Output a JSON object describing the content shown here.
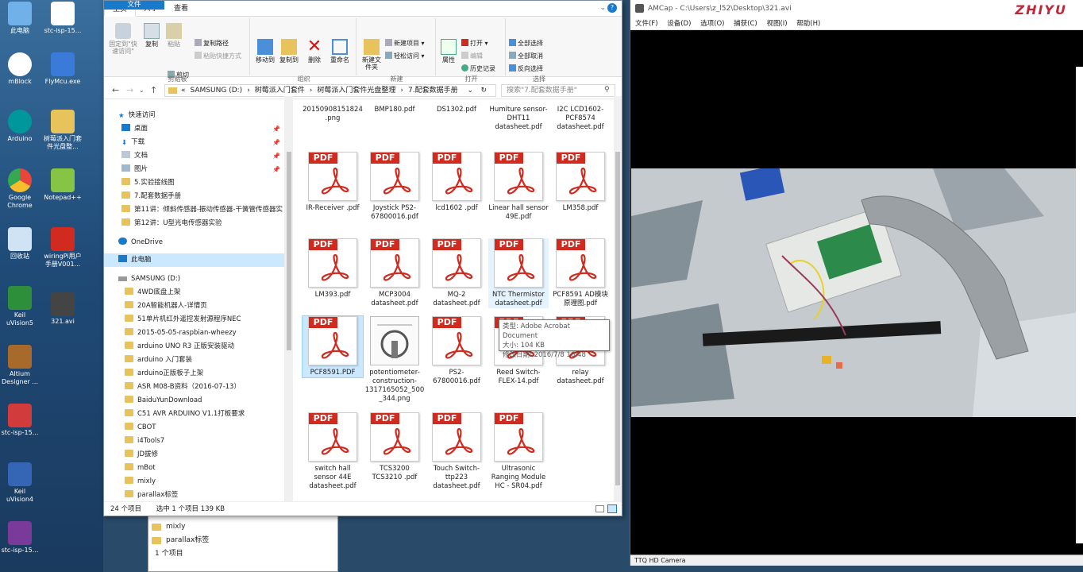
{
  "desktop": {
    "left_icons": [
      {
        "label": "此电脑",
        "color": "#6fb1e8"
      },
      {
        "label": "mBlock",
        "color": "#ffffff"
      },
      {
        "label": "Arduino",
        "color": "#00979c"
      },
      {
        "label": "Google Chrome",
        "color": "#e8453c"
      },
      {
        "label": "回收站",
        "color": "#cfe3f5"
      },
      {
        "label": "Keil uVision5",
        "color": "#2d8f3a"
      },
      {
        "label": "Altium Designer ...",
        "color": "#a86a2a"
      },
      {
        "label": "stc-isp-15...",
        "color": "#d23b3b"
      },
      {
        "label": "Keil uVision4",
        "color": "#3566b5"
      },
      {
        "label": "stc-isp-15...",
        "color": "#7a3a9a"
      }
    ],
    "right_icons": [
      {
        "label": "stc-isp-15...",
        "color": "#ffffff"
      },
      {
        "label": "FlyMcu.exe",
        "color": "#3a7ad8"
      },
      {
        "label": "树莓派入门套件光盘整...",
        "color": "#e8c25a"
      },
      {
        "label": "Notepad++",
        "color": "#86c446"
      },
      {
        "label": "wiringPi用户手册V001...",
        "color": "#d12a1e"
      },
      {
        "label": "321.avi",
        "color": "#444444"
      }
    ]
  },
  "background_explorer": {
    "rows": [
      "mixly",
      "parallax标签"
    ],
    "status": "1 个项目"
  },
  "explorer": {
    "tabs": {
      "file": "文件",
      "home": "主页",
      "share": "共享",
      "view": "查看"
    },
    "ribbon": {
      "clipboard": {
        "label": "剪贴板",
        "pin": "固定到\"快速访问\"",
        "copy": "复制",
        "paste": "粘贴",
        "copy_path": "复制路径",
        "paste_shortcut": "粘贴快捷方式",
        "cut": "剪切"
      },
      "organize": {
        "label": "组织",
        "move_to": "移动到",
        "copy_to": "复制到",
        "delete": "删除",
        "rename": "重命名"
      },
      "new": {
        "label": "新建",
        "new_folder": "新建文件夹",
        "new_item": "新建项目",
        "easy_access": "轻松访问"
      },
      "open": {
        "label": "打开",
        "properties": "属性",
        "open": "打开",
        "edit": "编辑",
        "history": "历史记录"
      },
      "select": {
        "label": "选择",
        "select_all": "全部选择",
        "select_none": "全部取消",
        "invert": "反向选择"
      }
    },
    "address": {
      "crumbs": [
        "«",
        "SAMSUNG (D:)",
        "›",
        "树莓派入门套件",
        "›",
        "树莓派入门套件光盘整理",
        "›",
        "7.配套数据手册"
      ],
      "search_placeholder": "搜索\"7.配套数据手册\""
    },
    "nav": {
      "quick_access": "快速访问",
      "desktop": "桌面",
      "downloads": "下载",
      "documents": "文档",
      "pictures": "图片",
      "qa_folders": [
        "5.实验接线图",
        "7.配套数据手册",
        "第11讲：倾斜传感器-振动传感器-干簧管传感器实",
        "第12讲：U型光电传感器实验"
      ],
      "onedrive": "OneDrive",
      "this_pc": "此电脑",
      "drive": "SAMSUNG (D:)",
      "drive_folders": [
        "4WD底盘上架",
        "20A智能机器人-详情页",
        "51单片机红外遥控发射源程序NEC",
        "2015-05-05-raspbian-wheezy",
        "arduino UNO R3 正版安装驱动",
        "arduino 入门套装",
        "arduino正版板子上架",
        "ASR M08-B资料（2016-07-13）",
        "BaiduYunDownload",
        "C51 AVR ARDUINO V1.1打板要求",
        "CBOT",
        "i4Tools7",
        "JD拔修",
        "mBot",
        "mixly",
        "parallax标签"
      ]
    },
    "files_top": [
      "20150908151824.png",
      "BMP180.pdf",
      "DS1302.pdf",
      "Humiture sensor-DHT11 datasheet.pdf",
      "I2C LCD1602-PCF8574 datasheet.pdf"
    ],
    "files": [
      "IR-Receiver .pdf",
      "Joystick PS2-67800016.pdf",
      "lcd1602 .pdf",
      "Linear hall sensor 49E.pdf",
      "LM358.pdf",
      "LM393.pdf",
      "MCP3004 datasheet.pdf",
      "MQ-2 datasheet.pdf",
      "NTC Thermistor datasheet.pdf",
      "PCF8591 AD模块原理图.pdf",
      "PCF8591.PDF",
      "potentiometer-construction-1317165052_500_344.png",
      "PS2-67800016.pdf",
      "Reed Switch-FLEX-14.pdf",
      "relay datasheet.pdf",
      "switch hall sensor 44E datasheet.pdf",
      "TCS3200 TCS3210 .pdf",
      "Touch Switch-ttp223 datasheet.pdf",
      "Ultrasonic Ranging Module HC - SR04.pdf"
    ],
    "pdf_badge": "PDF",
    "tooltip": {
      "type": "类型: Adobe Acrobat Document",
      "size": "大小: 104 KB",
      "date": "修改日期: 2016/7/8 16:48"
    },
    "status": {
      "count": "24 个项目",
      "selected": "选中 1 个项目  139 KB"
    }
  },
  "amcap": {
    "title": "AMCap - C:\\Users\\z_l52\\Desktop\\321.avi",
    "menu": [
      "文件(F)",
      "设备(D)",
      "选项(O)",
      "捕获(C)",
      "视图(I)",
      "帮助(H)"
    ],
    "status": "TTQ HD Camera"
  },
  "watermark": "ZHIYU",
  "colors": {
    "accent": "#1979ca",
    "selection": "#cce8ff",
    "pdf_red": "#d12a1e",
    "folder": "#e8c25a"
  }
}
